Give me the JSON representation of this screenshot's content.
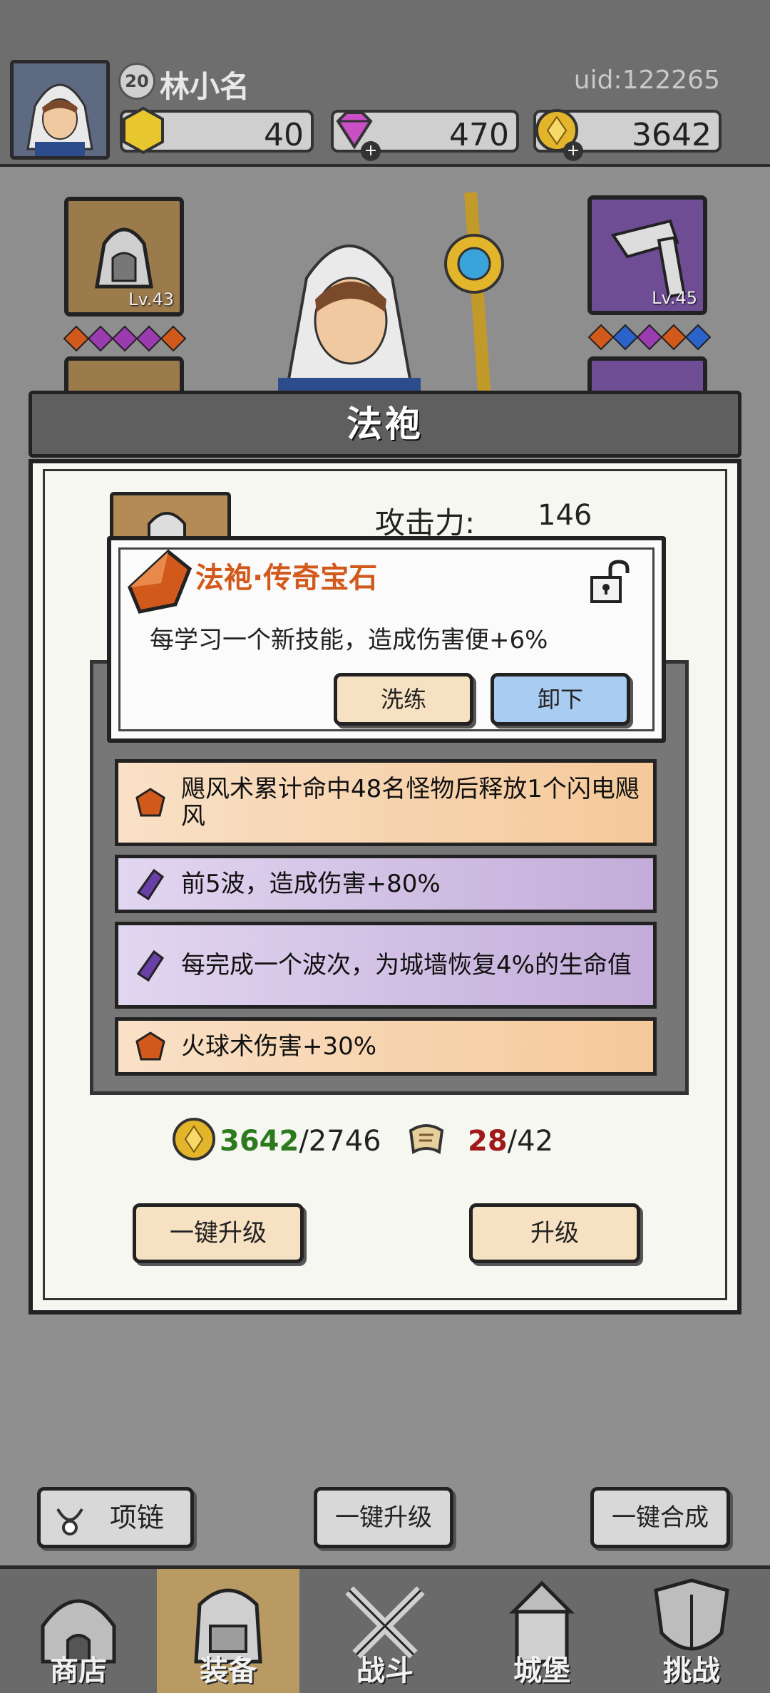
{
  "player": {
    "level": "20",
    "name": "林小名",
    "uid": "uid:122265"
  },
  "resources": {
    "energy": "40",
    "gems": "470",
    "gold": "3642"
  },
  "equipment": {
    "left_slot_level": "Lv.43",
    "right_slot_level": "Lv.45",
    "left_gem_colors": [
      "#d2591c",
      "#9a3bb0",
      "#9a3bb0",
      "#9a3bb0",
      "#d2591c"
    ],
    "right_gem_colors": [
      "#d2591c",
      "#2a63c9",
      "#9a3bb0",
      "#d2591c",
      "#2a63c9"
    ]
  },
  "modal": {
    "title": "法袍",
    "attack_label": "攻击力:",
    "attack_value": "146",
    "gem_rows": [
      {
        "text": "飓风术累计命中48名怪物后释放1个闪电飓风",
        "type": "orange"
      },
      {
        "text": "前5波，造成伤害+80%",
        "type": "purple"
      },
      {
        "text": "每完成一个波次，为城墙恢复4%的生命值",
        "type": "purple"
      },
      {
        "text": "火球术伤害+30%",
        "type": "orange"
      }
    ],
    "gold_have": "3642",
    "gold_need": "/2746",
    "scroll_have": "28",
    "scroll_need": "/42",
    "upgrade_all_label": "一键升级",
    "upgrade_label": "升级"
  },
  "popup": {
    "title": "法袍·传奇宝石",
    "description": "每学习一个新技能，造成伤害便+6%",
    "reroll_label": "洗练",
    "unequip_label": "卸下"
  },
  "bottom_buttons": {
    "necklace_label": "项链",
    "upgrade_all_label": "一键升级",
    "merge_all_label": "一键合成"
  },
  "nav": {
    "items": [
      "商店",
      "装备",
      "战斗",
      "城堡",
      "挑战"
    ],
    "active": "装备"
  },
  "colors": {
    "orange_gem": "#d2591c",
    "purple_gem": "#6b3fa8",
    "unequip_button": "#a9ccf2",
    "gold_have": "#2d7a1e",
    "scroll_have": "#a11a1a"
  }
}
